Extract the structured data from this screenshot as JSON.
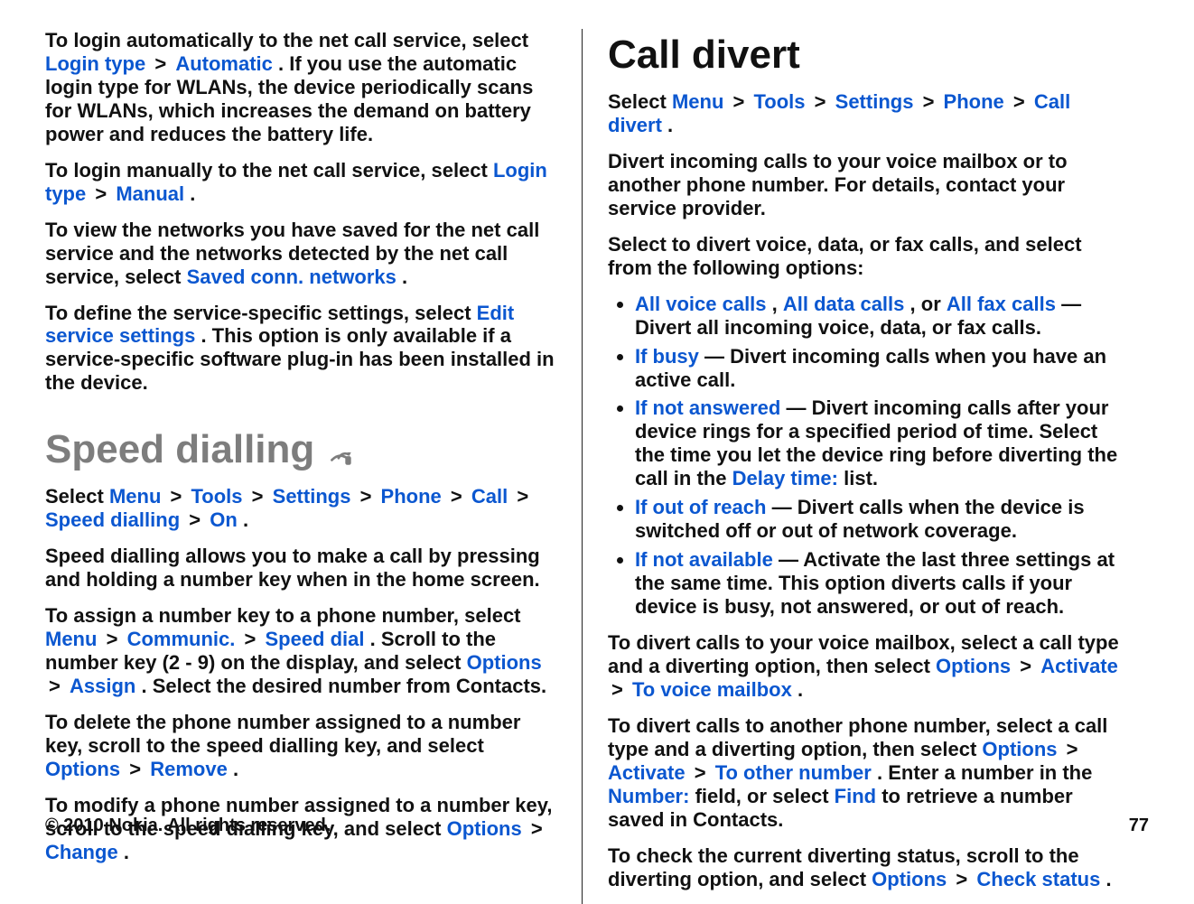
{
  "footer": {
    "copyright": "© 2010 Nokia. All rights reserved.",
    "page": "77"
  },
  "left": {
    "p1": {
      "t1": "To login automatically to the net call service, select ",
      "b1": "Login type",
      "b2": "Automatic",
      "t2": ". If you use the automatic login type for WLANs, the device periodically scans for WLANs, which increases the demand on battery power and reduces the battery life."
    },
    "p2": {
      "t1": "To login manually to the net call service, select ",
      "b1": "Login type",
      "b2": "Manual",
      "t2": "."
    },
    "p3": {
      "t1": "To view the networks you have saved for the net call service and the networks detected by the net call service, select ",
      "b1": "Saved conn. networks",
      "t2": "."
    },
    "p4": {
      "t1": "To define the service-specific settings, select ",
      "b1": "Edit service settings",
      "t2": ". This option is only available if a service-specific software plug-in has been installed in the device."
    },
    "h_speed": "Speed dialling",
    "sp_path": {
      "t1": "Select ",
      "m": [
        "Menu",
        "Tools",
        "Settings",
        "Phone",
        "Call",
        "Speed dialling",
        "On"
      ],
      "t2": "."
    },
    "sp_p1": "Speed dialling allows you to make a call by pressing and holding a number key when in the home screen.",
    "sp_p2": {
      "t1": "To assign a number key to a phone number, select ",
      "m1": [
        "Menu",
        "Communic.",
        "Speed dial"
      ],
      "t2": ". Scroll to the number key (2 - 9) on the display, and select ",
      "m2": [
        "Options",
        "Assign"
      ],
      "t3": ". Select the desired number from Contacts."
    },
    "sp_p3": {
      "t1": "To delete the phone number assigned to a number key, scroll to the speed dialling key, and select ",
      "m": [
        "Options",
        "Remove"
      ],
      "t2": "."
    },
    "sp_p4": {
      "t1": "To modify a phone number assigned to a number key, scroll to the speed dialling key, and select ",
      "m": [
        "Options",
        "Change"
      ],
      "t2": "."
    }
  },
  "right": {
    "h_divert": "Call divert",
    "cd_path": {
      "t1": "Select ",
      "m": [
        "Menu",
        "Tools",
        "Settings",
        "Phone",
        "Call divert"
      ],
      "t2": "."
    },
    "cd_p1": "Divert incoming calls to your voice mailbox or to another phone number. For details, contact your service provider.",
    "cd_p2": "Select to divert voice, data, or fax calls, and select from the following options:",
    "li1": {
      "b1": "All voice calls",
      "c1": ", ",
      "b2": "All data calls",
      "c2": ", or ",
      "b3": "All fax calls",
      "t": " — Divert all incoming voice, data, or fax calls."
    },
    "li2": {
      "b": "If busy",
      "t": "  — Divert incoming calls when you have an active call."
    },
    "li3": {
      "b1": "If not answered",
      "t1": "  — Divert incoming calls after your device rings for a specified period of time. Select the time you let the device ring before diverting the call in the ",
      "b2": "Delay time:",
      "t2": " list."
    },
    "li4": {
      "b": "If out of reach",
      "t": "  — Divert calls when the device is switched off or out of network coverage."
    },
    "li5": {
      "b": "If not available",
      "t": "  — Activate the last three settings at the same time. This option diverts calls if your device is busy, not answered, or out of reach."
    },
    "cd_p3": {
      "t1": "To divert calls to your voice mailbox, select a call type and a diverting option, then select ",
      "m": [
        "Options",
        "Activate",
        "To voice mailbox"
      ],
      "t2": "."
    },
    "cd_p4": {
      "t1": "To divert calls to another phone number, select a call type and a diverting option, then select ",
      "m1": [
        "Options",
        "Activate",
        "To other number"
      ],
      "t2": ". Enter a number in the ",
      "b1": "Number:",
      "t3": " field, or select ",
      "b2": "Find",
      "t4": " to retrieve a number saved in Contacts."
    },
    "cd_p5": {
      "t1": "To check the current diverting status, scroll to the diverting option, and select ",
      "m": [
        "Options",
        "Check status"
      ],
      "t2": "."
    }
  }
}
